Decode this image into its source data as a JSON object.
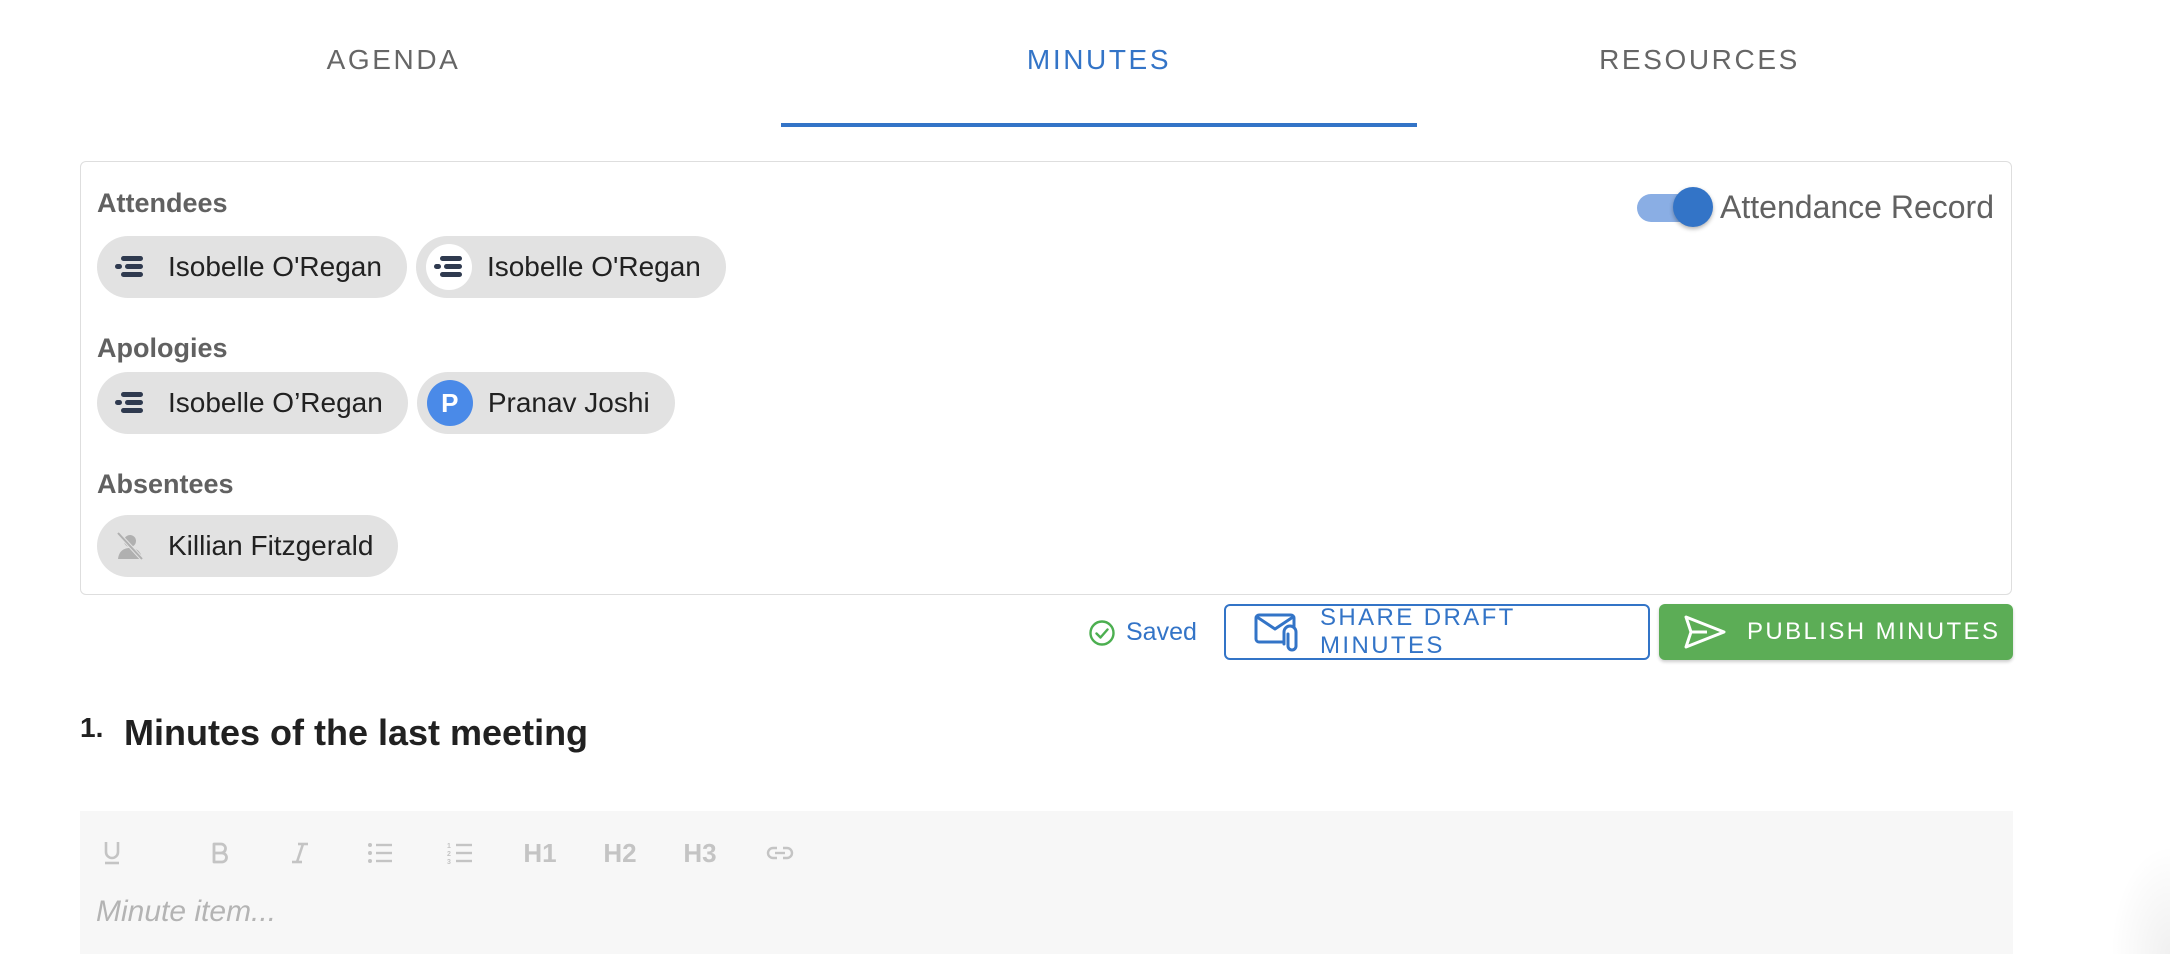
{
  "tabs": [
    {
      "label": "AGENDA"
    },
    {
      "label": "MINUTES"
    },
    {
      "label": "RESOURCES"
    }
  ],
  "active_tab": "MINUTES",
  "attendance": {
    "toggle_label": "Attendance Record",
    "toggle_on": true,
    "attendees_label": "Attendees",
    "attendees": [
      {
        "name": "Isobelle O'Regan",
        "avatar": "company-logo-icon"
      },
      {
        "name": "Isobelle O'Regan",
        "avatar": "company-logo-icon"
      }
    ],
    "apologies_label": "Apologies",
    "apologies": [
      {
        "name": "Isobelle O’Regan",
        "avatar": "company-logo-icon"
      },
      {
        "name": "Pranav Joshi",
        "avatar": "initial",
        "initial": "P"
      }
    ],
    "absentees_label": "Absentees",
    "absentees": [
      {
        "name": "Killian Fitzgerald",
        "avatar": "user-off-icon"
      }
    ]
  },
  "actions": {
    "saved_label": "Saved",
    "share_label": "SHARE DRAFT MINUTES",
    "publish_label": "PUBLISH MINUTES"
  },
  "agenda_item": {
    "number": "1.",
    "title": "Minutes of the last meeting"
  },
  "editor": {
    "tools": [
      {
        "name": "underline-icon"
      },
      {
        "name": "bold-icon"
      },
      {
        "name": "italic-icon"
      },
      {
        "name": "bullet-list-icon"
      },
      {
        "name": "numbered-list-icon"
      },
      {
        "label": "H1"
      },
      {
        "label": "H2"
      },
      {
        "label": "H3"
      },
      {
        "name": "link-icon"
      }
    ],
    "placeholder": "Minute item..."
  },
  "colors": {
    "primary": "#3374c7",
    "publish": "#5cad56",
    "chip_bg": "#e2e2e2"
  }
}
